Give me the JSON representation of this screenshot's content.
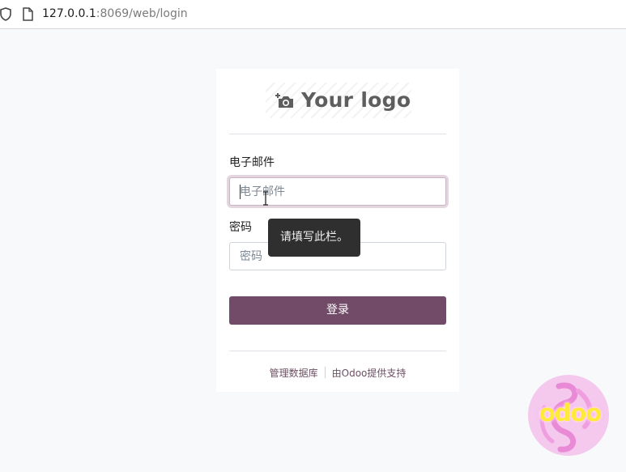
{
  "browser": {
    "url_host": "127.0.0.1",
    "url_rest": ":8069/web/login"
  },
  "logo": {
    "text": "Your logo",
    "icon": "camera-add-icon"
  },
  "form": {
    "email_label": "电子邮件",
    "email_placeholder": "电子邮件",
    "email_value": "",
    "password_label": "密码",
    "password_placeholder": "密码",
    "password_value": "",
    "submit_label": "登录",
    "tooltip": "请填写此栏。"
  },
  "footer": {
    "manage_db": "管理数据库",
    "powered_by": "由Odoo提供支持"
  },
  "badge": {
    "text": "odoo"
  },
  "colors": {
    "primary": "#714b67",
    "background": "#f8f9fb",
    "tooltip_bg": "#2f2f2f",
    "link": "#6c4f63"
  }
}
